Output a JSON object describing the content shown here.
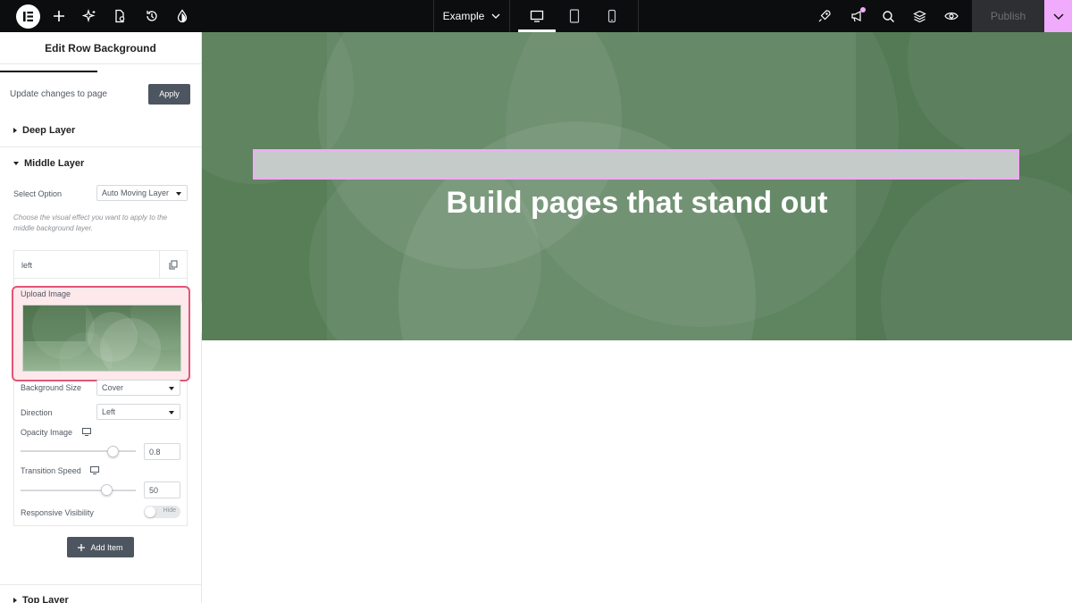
{
  "topbar": {
    "page_name": "Example",
    "publish_label": "Publish"
  },
  "panel": {
    "title": "Edit Row Background",
    "update_text": "Update changes to page",
    "apply_label": "Apply",
    "deep_layer": "Deep Layer",
    "middle_layer": "Middle Layer",
    "top_layer": "Top Layer",
    "select_option_label": "Select Option",
    "select_option_value": "Auto Moving Layer",
    "help_text": "Choose the visual effect you want to apply to the middle background layer.",
    "item": {
      "title": "left",
      "upload_label": "Upload Image",
      "bg_size_label": "Background Size",
      "bg_size_value": "Cover",
      "direction_label": "Direction",
      "direction_value": "Left",
      "opacity_label": "Opacity Image",
      "opacity_value": "0.8",
      "speed_label": "Transition Speed",
      "speed_value": "50",
      "visibility_label": "Responsive Visibility",
      "visibility_toggle": "Hide"
    },
    "add_item_label": "Add Item"
  },
  "canvas": {
    "headline": "Build pages that stand out"
  },
  "colors": {
    "accent": "#f0abfc",
    "highlight_border": "#e25575",
    "hero_green": "#5e8460"
  }
}
